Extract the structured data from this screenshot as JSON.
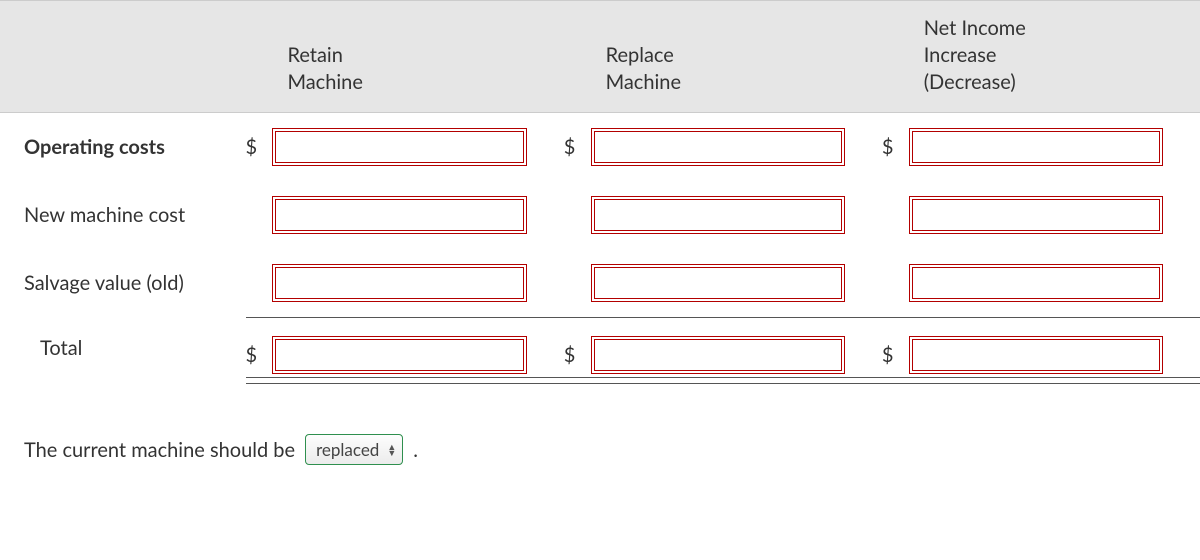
{
  "columns": {
    "label": "",
    "retain": "Retain\nMachine",
    "replace": "Replace\nMachine",
    "net": "Net Income\nIncrease\n(Decrease)"
  },
  "currency_symbol": "$",
  "rows": [
    {
      "key": "operating_costs",
      "label": "Operating costs",
      "bold": true,
      "indent": false,
      "show_dollar": true,
      "values": {
        "retain": "",
        "replace": "",
        "net": ""
      }
    },
    {
      "key": "new_machine_cost",
      "label": "New machine cost",
      "bold": false,
      "indent": false,
      "show_dollar": false,
      "values": {
        "retain": "",
        "replace": "",
        "net": ""
      }
    },
    {
      "key": "salvage_value_old",
      "label": "Salvage value (old)",
      "bold": false,
      "indent": false,
      "show_dollar": false,
      "values": {
        "retain": "",
        "replace": "",
        "net": ""
      }
    },
    {
      "key": "total",
      "label": "Total",
      "bold": false,
      "indent": true,
      "show_dollar": true,
      "values": {
        "retain": "",
        "replace": "",
        "net": ""
      }
    }
  ],
  "footer": {
    "prefix": "The current machine should be",
    "selected": "replaced",
    "suffix": "."
  }
}
